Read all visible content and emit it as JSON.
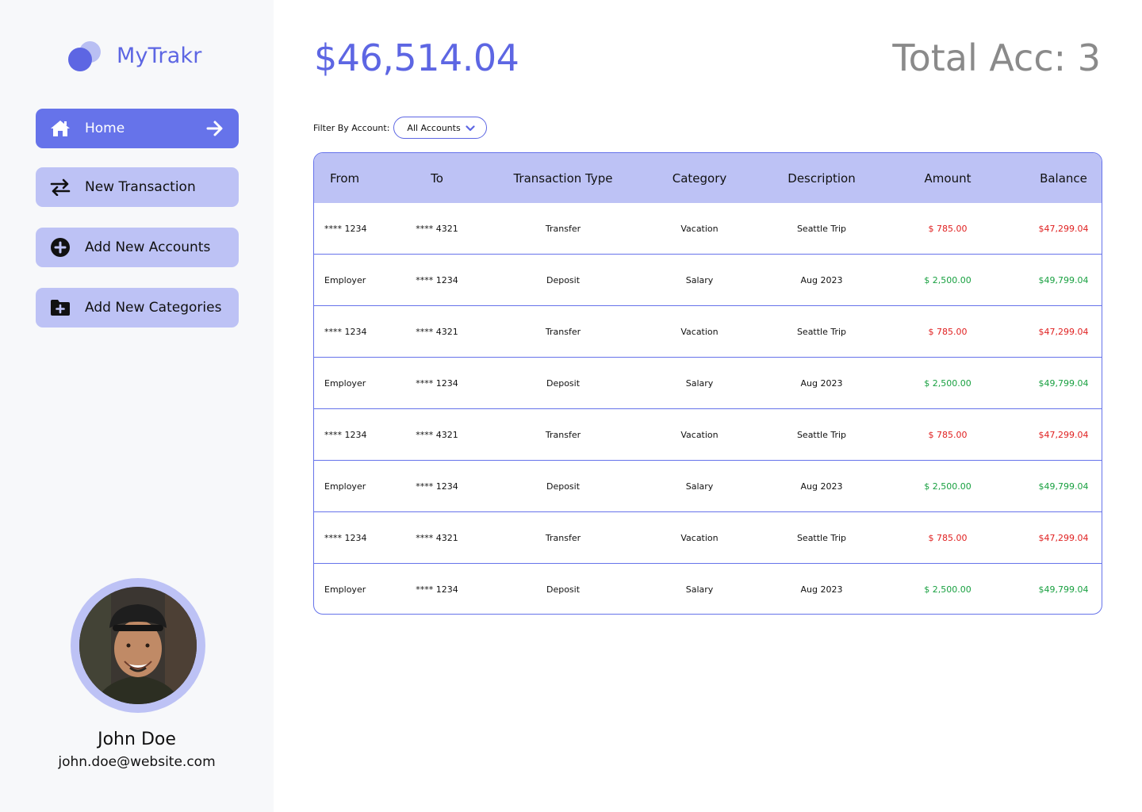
{
  "app": {
    "name": "MyTrakr"
  },
  "sidebar": {
    "items": [
      {
        "label": "Home",
        "icon": "home-icon",
        "active": true
      },
      {
        "label": "New Transaction",
        "icon": "swap-arrows-icon",
        "active": false
      },
      {
        "label": "Add New Accounts",
        "icon": "plus-circle-icon",
        "active": false
      },
      {
        "label": "Add New Categories",
        "icon": "folder-plus-icon",
        "active": false
      }
    ]
  },
  "user": {
    "name": "John Doe",
    "email": "john.doe@website.com"
  },
  "summary": {
    "balance": "$46,514.04",
    "total_accounts": "Total Acc: 3"
  },
  "filter": {
    "label": "Filter By Account:",
    "selected": "All Accounts"
  },
  "table": {
    "headers": [
      "From",
      "To",
      "Transaction Type",
      "Category",
      "Description",
      "Amount",
      "Balance"
    ],
    "rows": [
      {
        "from": "**** 1234",
        "to": "**** 4321",
        "type": "Transfer",
        "category": "Vacation",
        "description": "Seattle Trip",
        "amount": "$ 785.00",
        "balance": "$47,299.04",
        "sign": "neg"
      },
      {
        "from": "Employer",
        "to": "**** 1234",
        "type": "Deposit",
        "category": "Salary",
        "description": "Aug 2023",
        "amount": "$ 2,500.00",
        "balance": "$49,799.04",
        "sign": "pos"
      },
      {
        "from": "**** 1234",
        "to": "**** 4321",
        "type": "Transfer",
        "category": "Vacation",
        "description": "Seattle Trip",
        "amount": "$ 785.00",
        "balance": "$47,299.04",
        "sign": "neg"
      },
      {
        "from": "Employer",
        "to": "**** 1234",
        "type": "Deposit",
        "category": "Salary",
        "description": "Aug 2023",
        "amount": "$ 2,500.00",
        "balance": "$49,799.04",
        "sign": "pos"
      },
      {
        "from": "**** 1234",
        "to": "**** 4321",
        "type": "Transfer",
        "category": "Vacation",
        "description": "Seattle Trip",
        "amount": "$ 785.00",
        "balance": "$47,299.04",
        "sign": "neg"
      },
      {
        "from": "Employer",
        "to": "**** 1234",
        "type": "Deposit",
        "category": "Salary",
        "description": "Aug 2023",
        "amount": "$ 2,500.00",
        "balance": "$49,799.04",
        "sign": "pos"
      },
      {
        "from": "**** 1234",
        "to": "**** 4321",
        "type": "Transfer",
        "category": "Vacation",
        "description": "Seattle Trip",
        "amount": "$ 785.00",
        "balance": "$47,299.04",
        "sign": "neg"
      },
      {
        "from": "Employer",
        "to": "**** 1234",
        "type": "Deposit",
        "category": "Salary",
        "description": "Aug 2023",
        "amount": "$ 2,500.00",
        "balance": "$49,799.04",
        "sign": "pos"
      }
    ]
  },
  "colors": {
    "accent": "#5d66e3",
    "accent_light": "#bdc2f5",
    "negative": "#e02020",
    "positive": "#18a040",
    "muted": "#8a8a8a"
  }
}
